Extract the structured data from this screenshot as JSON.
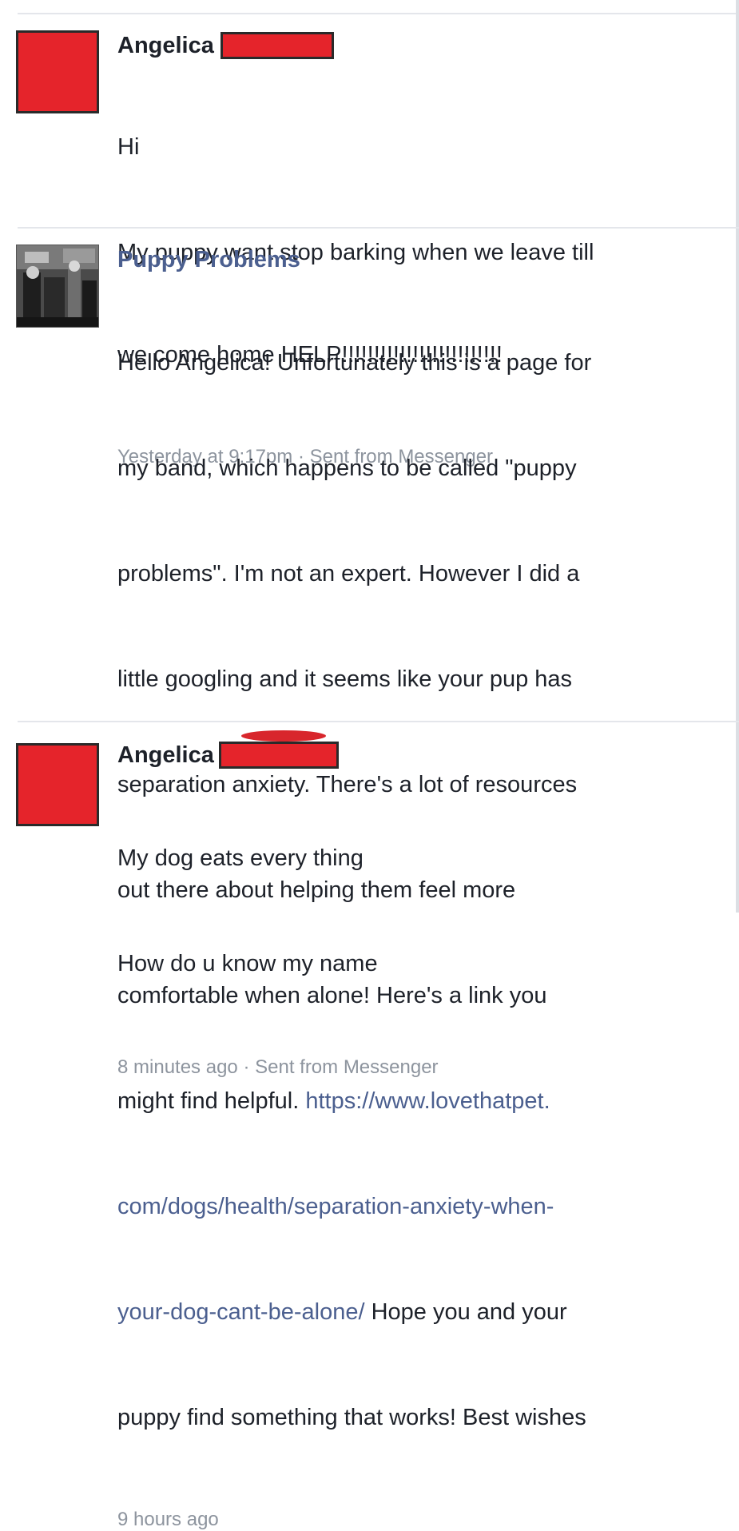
{
  "messages": [
    {
      "sender": "Angelica",
      "lines": [
        "Hi",
        "My puppy want stop barking when we leave till",
        "we come home HELP!!!!!!!!!!!!!!!!!!!!!!!!!"
      ],
      "timestamp": "Yesterday at 9:17pm",
      "separator": "·",
      "source": "Sent from Messenger"
    },
    {
      "sender": "Puppy Problems",
      "lines": [
        "Hello Angelica! Unfortunately this is a page for",
        "my band, which happens to be called \"puppy",
        "problems\". I'm not an expert. However I did a",
        "little googling and it seems like your pup has",
        "separation anxiety. There's a lot of resources",
        "out there about helping them feel more",
        "comfortable when alone! Here's a link you"
      ],
      "link_lead": "might find helpful. ",
      "link_part1": "https://www.lovethatpet.",
      "link_part2": "com/dogs/health/separation-anxiety-when-",
      "link_part3": "your-dog-cant-be-alone/",
      "after_link": " Hope you and your",
      "closing_line": "puppy find something that works! Best wishes",
      "timestamp": "9 hours ago"
    },
    {
      "sender": "Angelica",
      "lines": [
        "My dog eats every thing",
        "How do u know my name"
      ],
      "timestamp": "8 minutes ago",
      "separator": "·",
      "source": "Sent from Messenger"
    }
  ],
  "colors": {
    "redaction": "#e5242b",
    "page_name": "#4b5f8f",
    "meta_text": "#8d949e",
    "divider": "#e4e6eb"
  }
}
